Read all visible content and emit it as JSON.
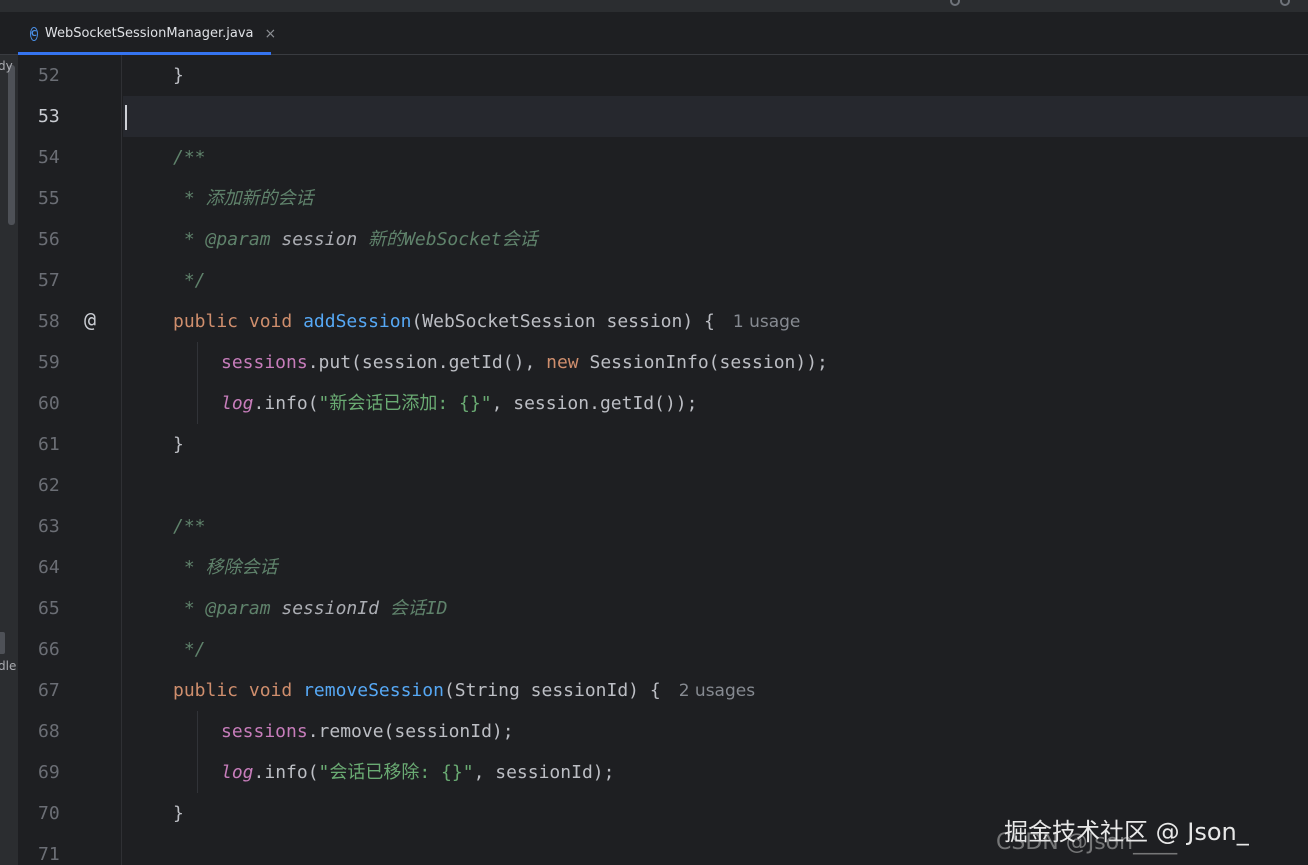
{
  "tab": {
    "file_name": "WebSocketSessionManager.java",
    "icon": "java-class-icon",
    "icon_glyph": "C",
    "close_glyph": "×"
  },
  "side_panel": {
    "fragment_top": "dy",
    "fragment_bottom": "dle"
  },
  "editor": {
    "current_line": 53,
    "gutter_marker": "@",
    "lines": [
      {
        "n": "52"
      },
      {
        "n": "53"
      },
      {
        "n": "54"
      },
      {
        "n": "55"
      },
      {
        "n": "56"
      },
      {
        "n": "57"
      },
      {
        "n": "58"
      },
      {
        "n": "59"
      },
      {
        "n": "60"
      },
      {
        "n": "61"
      },
      {
        "n": "62"
      },
      {
        "n": "63"
      },
      {
        "n": "64"
      },
      {
        "n": "65"
      },
      {
        "n": "66"
      },
      {
        "n": "67"
      },
      {
        "n": "68"
      },
      {
        "n": "69"
      },
      {
        "n": "70"
      },
      {
        "n": "71"
      }
    ],
    "code": {
      "l52": "}",
      "l54": "/**",
      "l55": " * 添加新的会话",
      "l56_star": " * ",
      "l56_tag": "@param",
      "l56_name": " session",
      "l56_desc": " 新的WebSocket会话",
      "l57": " */",
      "l58_kw1": "public",
      "l58_kw2": " void ",
      "l58_fn": "addSession",
      "l58_rest": "(WebSocketSession session) {",
      "l58_usage": "1 usage",
      "l59_field": "sessions",
      "l59_a": ".put(session.getId(), ",
      "l59_new": "new",
      "l59_b": " SessionInfo(session));",
      "l60_log": "log",
      "l60_a": ".info(",
      "l60_str": "\"新会话已添加: {}\"",
      "l60_b": ", session.getId());",
      "l61": "}",
      "l63": "/**",
      "l64": " * 移除会话",
      "l65_star": " * ",
      "l65_tag": "@param",
      "l65_name": " sessionId",
      "l65_desc": " 会话ID",
      "l66": " */",
      "l67_kw1": "public",
      "l67_kw2": " void ",
      "l67_fn": "removeSession",
      "l67_rest": "(String sessionId) {",
      "l67_usage": "2 usages",
      "l68_field": "sessions",
      "l68_a": ".remove(sessionId);",
      "l69_log": "log",
      "l69_a": ".info(",
      "l69_str": "\"会话已移除: {}\"",
      "l69_b": ", sessionId);",
      "l70": "}"
    }
  },
  "watermark": {
    "line1": "掘金技术社区 @ Json_",
    "line2": "CSDN @Json____"
  }
}
